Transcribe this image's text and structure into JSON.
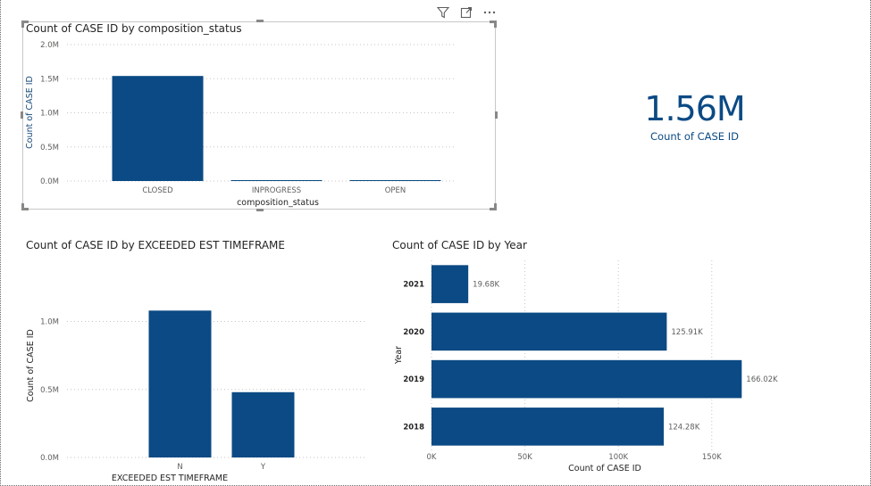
{
  "header_icons": [
    "filter-icon",
    "focus-mode-icon",
    "more-options-icon"
  ],
  "card": {
    "value": "1.56M",
    "label": "Count of CASE ID"
  },
  "chart_data": [
    {
      "type": "bar",
      "title": "Count of CASE ID by composition_status",
      "xlabel": "composition_status",
      "ylabel": "Count of CASE ID",
      "categories": [
        "CLOSED",
        "INPROGRESS",
        "OPEN"
      ],
      "values": [
        1540000,
        5000,
        2000
      ],
      "ylim": [
        0,
        2000000
      ],
      "yticks": [
        0,
        500000,
        1000000,
        1500000,
        2000000
      ],
      "ytick_labels": [
        "0.0M",
        "0.5M",
        "1.0M",
        "1.5M",
        "2.0M"
      ],
      "grid": true,
      "color": "#0b4a84"
    },
    {
      "type": "bar",
      "title": "Count of CASE ID by EXCEEDED EST TIMEFRAME",
      "xlabel": "EXCEEDED EST TIMEFRAME",
      "ylabel": "Count of CASE ID",
      "categories": [
        "N",
        "Y"
      ],
      "values": [
        1080000,
        480000
      ],
      "ylim": [
        0,
        1200000
      ],
      "yticks": [
        0,
        500000,
        1000000
      ],
      "ytick_labels": [
        "0.0M",
        "0.5M",
        "1.0M"
      ],
      "grid": true,
      "color": "#0b4a84"
    },
    {
      "type": "bar",
      "orientation": "horizontal",
      "title": "Count of CASE ID by Year",
      "xlabel": "Count of CASE ID",
      "ylabel": "Year",
      "categories": [
        "2021",
        "2020",
        "2019",
        "2018"
      ],
      "values": [
        19680,
        125910,
        166020,
        124280
      ],
      "data_labels": [
        "19.68K",
        "125.91K",
        "166.02K",
        "124.28K"
      ],
      "xlim": [
        0,
        185000
      ],
      "xticks": [
        0,
        50000,
        100000,
        150000
      ],
      "xtick_labels": [
        "0K",
        "50K",
        "100K",
        "150K"
      ],
      "grid": true,
      "color": "#0b4a84"
    }
  ]
}
